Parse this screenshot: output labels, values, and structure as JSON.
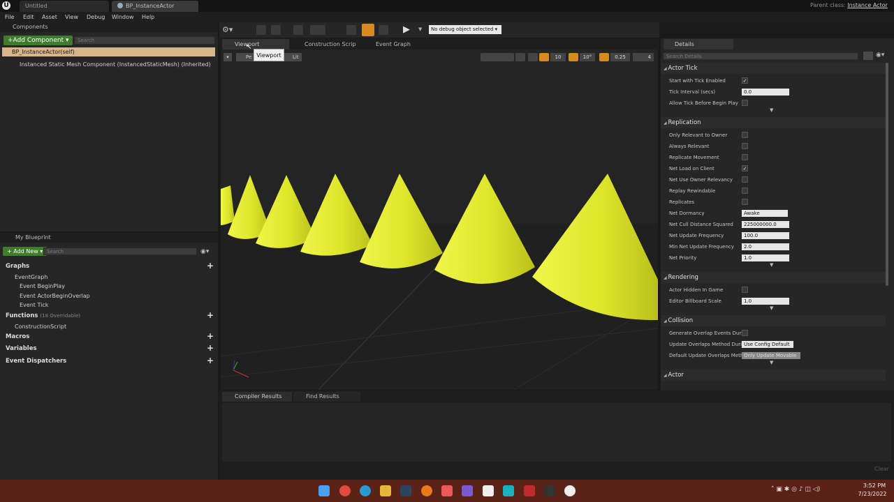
{
  "tabs": [
    "Untitled",
    "BP_InstanceActor"
  ],
  "parent_class_label": "Parent class:",
  "parent_class_value": "Instance Actor",
  "menu": [
    "File",
    "Edit",
    "Asset",
    "View",
    "Debug",
    "Window",
    "Help"
  ],
  "components": {
    "title": "Components",
    "add_button": "Add Component",
    "search_placeholder": "Search",
    "items": [
      "BP_InstanceActor(self)",
      "Instanced Static Mesh Component (InstancedStaticMesh) (Inherited)"
    ]
  },
  "my_blueprint": {
    "title": "My Blueprint",
    "add_button": "Add New",
    "search_placeholder": "Search",
    "graphs_label": "Graphs",
    "eventgraph_label": "EventGraph",
    "events": [
      "Event BeginPlay",
      "Event ActorBeginOverlap",
      "Event Tick"
    ],
    "functions_label": "Functions",
    "functions_count": "(18 Overridable)",
    "construction_script": "ConstructionScript",
    "macros_label": "Macros",
    "variables_label": "Variables",
    "dispatchers_label": "Event Dispatchers"
  },
  "toolbar": {
    "debug_select": "No debug object selected"
  },
  "editor_tabs": [
    "Viewport",
    "Construction Scrip",
    "Event Graph"
  ],
  "tooltip": "Viewport",
  "viewport_toolbar": {
    "perspective": "Pe",
    "lit": "Lit",
    "grid_snap": "10",
    "rot_snap": "10°",
    "scale_snap": "0.25",
    "cam_speed": "4"
  },
  "bottom_tabs": [
    "Compiler Results",
    "Find Results"
  ],
  "clear_label": "Clear",
  "details": {
    "title": "Details",
    "search_placeholder": "Search Details",
    "categories": [
      {
        "name": "Actor Tick",
        "rows": [
          {
            "label": "Start with Tick Enabled",
            "type": "check",
            "checked": true
          },
          {
            "label": "Tick Interval (secs)",
            "type": "num",
            "value": "0.0"
          },
          {
            "label": "Allow Tick Before Begin Play",
            "type": "check",
            "checked": false
          }
        ]
      },
      {
        "name": "Replication",
        "rows": [
          {
            "label": "Only Relevant to Owner",
            "type": "check",
            "checked": false
          },
          {
            "label": "Always Relevant",
            "type": "check",
            "checked": false
          },
          {
            "label": "Replicate Movement",
            "type": "check",
            "checked": false
          },
          {
            "label": "Net Load on Client",
            "type": "check",
            "checked": true
          },
          {
            "label": "Net Use Owner Relevancy",
            "type": "check",
            "checked": false
          },
          {
            "label": "Replay Rewindable",
            "type": "check",
            "checked": false
          },
          {
            "label": "Replicates",
            "type": "check",
            "checked": false
          },
          {
            "label": "Net Dormancy",
            "type": "dd",
            "value": "Awake"
          },
          {
            "label": "Net Cull Distance Squared",
            "type": "num",
            "value": "225000000.0"
          },
          {
            "label": "Net Update Frequency",
            "type": "num",
            "value": "100.0"
          },
          {
            "label": "Min Net Update Frequency",
            "type": "num",
            "value": "2.0"
          },
          {
            "label": "Net Priority",
            "type": "num",
            "value": "1.0"
          }
        ]
      },
      {
        "name": "Rendering",
        "rows": [
          {
            "label": "Actor Hidden In Game",
            "type": "check",
            "checked": false
          },
          {
            "label": "Editor Billboard Scale",
            "type": "num",
            "value": "1.0"
          }
        ]
      },
      {
        "name": "Collision",
        "rows": [
          {
            "label": "Generate Overlap Events Durin",
            "type": "check",
            "checked": false
          },
          {
            "label": "Update Overlaps Method Durin",
            "type": "dd",
            "value": "Use Config Default"
          },
          {
            "label": "Default Update Overlaps Meth",
            "type": "dd",
            "value": "Only Update Movable"
          }
        ]
      },
      {
        "name": "Actor",
        "rows": []
      }
    ]
  },
  "clock": {
    "time": "3:52 PM",
    "date": "7/23/2022"
  },
  "colors": {
    "accent_green": "#3e7d2c",
    "cone_yellow": "#e2ea2a",
    "selection": "#d8b48a",
    "taskbar": "#5a2218"
  }
}
